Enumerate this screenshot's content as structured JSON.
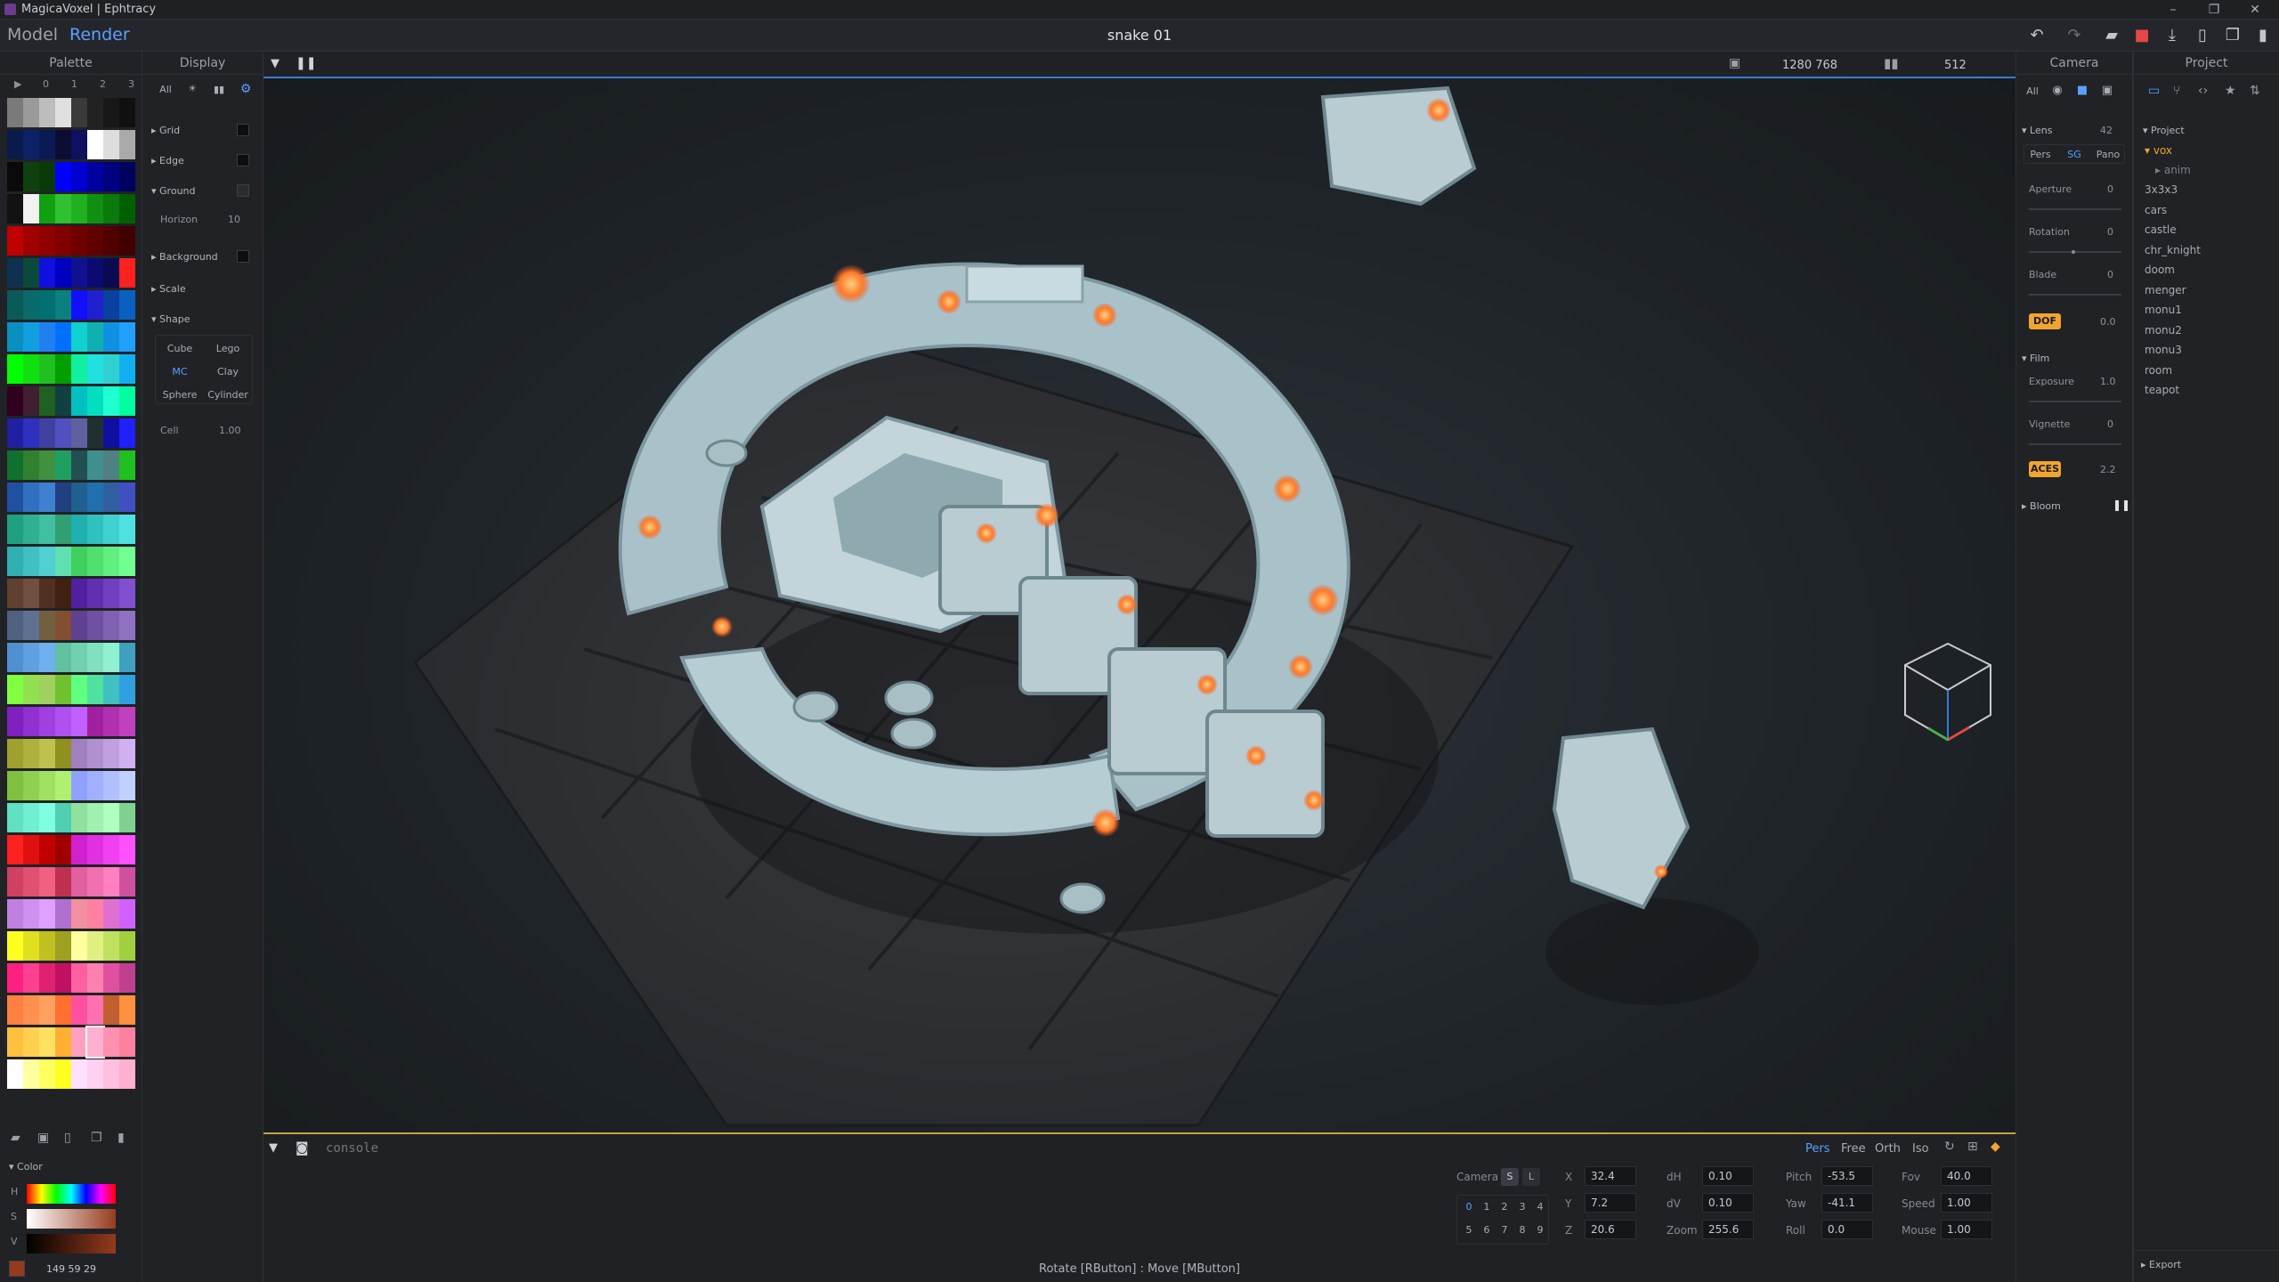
{
  "window": {
    "title": "MagicaVoxel | Ephtracy",
    "minimize": "–",
    "maximize": "❐",
    "close": "✕"
  },
  "menubar": {
    "model": "Model",
    "render": "Render",
    "doc_title": "snake 01"
  },
  "toolbar_icons": [
    "undo-icon",
    "redo-icon",
    "open-icon",
    "save-icon",
    "export-icon",
    "new-icon",
    "copy-icon",
    "delete-icon"
  ],
  "palette": {
    "title": "Palette",
    "pages": [
      "▶",
      "0",
      "1",
      "2",
      "3"
    ],
    "swatches": [
      "#7a7a7a",
      "#9a9a9a",
      "#bdbdbd",
      "#e0e0e0",
      "#3a3a3a",
      "#222222",
      "#181818",
      "#101010",
      "#0a1a4a",
      "#0b2266",
      "#0a1a55",
      "#0d0d33",
      "#101060",
      "#ffffff",
      "#dddddd",
      "#aaaaaa",
      "#0a0a0a",
      "#104010",
      "#0a3a0a",
      "#0000ff",
      "#0000d0",
      "#0000a0",
      "#000080",
      "#000060",
      "#121212",
      "#f2f2f2",
      "#10a010",
      "#30c030",
      "#20b020",
      "#109010",
      "#0a7a0a",
      "#006000",
      "#c00000",
      "#a00000",
      "#900000",
      "#800000",
      "#700000",
      "#600000",
      "#500000",
      "#400000",
      "#103050",
      "#0a4a3a",
      "#1010e0",
      "#0000c0",
      "#101090",
      "#0a0a70",
      "#0a0a50",
      "#ff2020",
      "#0a5a5a",
      "#0a6a6a",
      "#007070",
      "#0a8080",
      "#1010ff",
      "#2020d0",
      "#0a40a0",
      "#0a60c0",
      "#0a90c0",
      "#10a0e0",
      "#2080f0",
      "#0070ff",
      "#10d0d0",
      "#10b0b0",
      "#1090e0",
      "#20a0ff",
      "#00ff00",
      "#10e010",
      "#20c020",
      "#00a000",
      "#10f0a0",
      "#20e0e0",
      "#30d0d0",
      "#10b0f0",
      "#300020",
      "#402030",
      "#206020",
      "#104040",
      "#00c0c0",
      "#00e0c0",
      "#20ffd0",
      "#00ffa0",
      "#2020a0",
      "#3030c0",
      "#4040a0",
      "#5050c0",
      "#6060a0",
      "#203030",
      "#1010a0",
      "#2020ff",
      "#107030",
      "#308030",
      "#409040",
      "#20a060",
      "#205050",
      "#409090",
      "#508080",
      "#20c020",
      "#2050a0",
      "#3070c0",
      "#4080d0",
      "#204080",
      "#206090",
      "#2070b0",
      "#3060a0",
      "#4050c0",
      "#20a080",
      "#30b090",
      "#40c0a0",
      "#30a070",
      "#20b0b0",
      "#30c0c0",
      "#40d0d0",
      "#50e0e0",
      "#30b0b0",
      "#40c0c0",
      "#50d0d0",
      "#60e0b0",
      "#40d060",
      "#50e070",
      "#60f080",
      "#70ff90",
      "#604030",
      "#705040",
      "#503020",
      "#402010",
      "#5020a0",
      "#6030b0",
      "#7040c0",
      "#8050d0",
      "#506080",
      "#607090",
      "#706040",
      "#805030",
      "#604090",
      "#7050a0",
      "#8060b0",
      "#9070c0",
      "#5090d0",
      "#60a0e0",
      "#70b0f0",
      "#60c0a0",
      "#70d0b0",
      "#80e0c0",
      "#90f0d0",
      "#40a0c0",
      "#80ff40",
      "#90e050",
      "#a0d060",
      "#70c030",
      "#60ff80",
      "#50e0a0",
      "#40c0c0",
      "#30a0e0",
      "#8020c0",
      "#9030d0",
      "#a040e0",
      "#b050f0",
      "#c060ff",
      "#a020a0",
      "#b030b0",
      "#c040c0",
      "#a0a030",
      "#b0b040",
      "#c0c050",
      "#909020",
      "#a080c0",
      "#b090d0",
      "#c0a0e0",
      "#d0b0f0",
      "#80c040",
      "#90d050",
      "#a0e060",
      "#b0f070",
      "#90a0ff",
      "#a0b0ff",
      "#b0c0ff",
      "#c0d0ff",
      "#60e0c0",
      "#70f0d0",
      "#80ffe0",
      "#50d0b0",
      "#90e0a0",
      "#a0f0b0",
      "#b0ffc0",
      "#80d090",
      "#ff2020",
      "#e01010",
      "#c00000",
      "#a00000",
      "#d020d0",
      "#e030e0",
      "#f040f0",
      "#ff50ff",
      "#d04060",
      "#e05070",
      "#f06080",
      "#c03050",
      "#e060a0",
      "#f070b0",
      "#ff80c0",
      "#d050a0",
      "#c080e0",
      "#d090f0",
      "#e0a0ff",
      "#b070d0",
      "#f090a0",
      "#ff80a0",
      "#e070d0",
      "#d060ff",
      "#ffff20",
      "#e0e020",
      "#c0c020",
      "#a0a020",
      "#ffffa0",
      "#e0f080",
      "#c0e060",
      "#a0d040",
      "#ff2080",
      "#ff4090",
      "#e02070",
      "#c01060",
      "#ff60a0",
      "#ff80b0",
      "#e050a0",
      "#c04090",
      "#ff8040",
      "#ff9050",
      "#ffa060",
      "#ff7030",
      "#ff50a0",
      "#ff70b0",
      "#c06030",
      "#ff9040",
      "#ffc040",
      "#ffd050",
      "#ffe060",
      "#ffb030",
      "#ffa0c0",
      "#ffb0d0",
      "#ff90b0",
      "#ff80a0",
      "#ffffff",
      "#ffffa0",
      "#ffff60",
      "#ffff20",
      "#ffe0ff",
      "#ffd0f0",
      "#ffc0e0",
      "#ffb0d0"
    ],
    "bottom_icons": [
      "folder-icon",
      "save-icon",
      "file-icon",
      "copy-icon",
      "trash-icon"
    ],
    "color_title": "Color",
    "hsv_labels": [
      "H",
      "S",
      "V"
    ],
    "rgb_readout": "149 59 29",
    "current_color": "#953b1d"
  },
  "display": {
    "title": "Display",
    "tabs": [
      "All",
      "☀",
      "▮▮",
      "⚙"
    ],
    "grid": "Grid",
    "edge": "Edge",
    "ground": "Ground",
    "horizon_label": "Horizon",
    "horizon_value": "10",
    "background": "Background",
    "scale": "Scale",
    "shape": "Shape",
    "shapes": [
      "Cube",
      "Lego",
      "MC",
      "Clay",
      "Sphere",
      "Cylinder"
    ],
    "cell_label": "Cell",
    "cell_value": "1.00"
  },
  "viewport_toolbar": {
    "resolution": "1280 768",
    "samples": "512"
  },
  "camera": {
    "title": "Camera",
    "tabs": [
      "All",
      "◉",
      "■",
      "▣"
    ],
    "lens_label": "Lens",
    "lens_value": "42",
    "lens_types": [
      "Pers",
      "SG",
      "Pano"
    ],
    "aperture_label": "Aperture",
    "aperture_value": "0",
    "rotation_label": "Rotation",
    "rotation_value": "0",
    "blade_label": "Blade",
    "blade_value": "0",
    "dof": "DOF",
    "dof_value": "0.0",
    "film_label": "Film",
    "exposure_label": "Exposure",
    "exposure_value": "1.0",
    "vignette_label": "Vignette",
    "vignette_value": "0",
    "aces": "ACES",
    "aces_value": "2.2",
    "bloom_label": "Bloom",
    "bloom_icon": "pause-icon"
  },
  "project": {
    "title": "Project",
    "root": "Project",
    "folder": "vox",
    "subfolder": "anim",
    "items": [
      "3x3x3",
      "cars",
      "castle",
      "chr_knight",
      "doom",
      "menger",
      "monu1",
      "monu2",
      "monu3",
      "room",
      "teapot"
    ],
    "export": "Export"
  },
  "console": {
    "placeholder": "console",
    "views": [
      "Pers",
      "Free",
      "Orth",
      "Iso"
    ],
    "camera_label": "Camera",
    "camera_modes": [
      "S",
      "L"
    ],
    "slots_row1": [
      "0",
      "1",
      "2",
      "3",
      "4"
    ],
    "slots_row2": [
      "5",
      "6",
      "7",
      "8",
      "9"
    ],
    "x_label": "X",
    "x_value": "32.4",
    "y_label": "Y",
    "y_value": "7.2",
    "z_label": "Z",
    "z_value": "20.6",
    "dh_label": "dH",
    "dh_value": "0.10",
    "dv_label": "dV",
    "dv_value": "0.10",
    "zoom_label": "Zoom",
    "zoom_value": "255.6",
    "pitch_label": "Pitch",
    "pitch_value": "-53.5",
    "yaw_label": "Yaw",
    "yaw_value": "-41.1",
    "roll_label": "Roll",
    "roll_value": "0.0",
    "fov_label": "Fov",
    "fov_value": "40.0",
    "speed_label": "Speed",
    "speed_value": "1.00",
    "mouse_label": "Mouse",
    "mouse_value": "1.00"
  },
  "status_bar": "Rotate [RButton] : Move [MButton]"
}
